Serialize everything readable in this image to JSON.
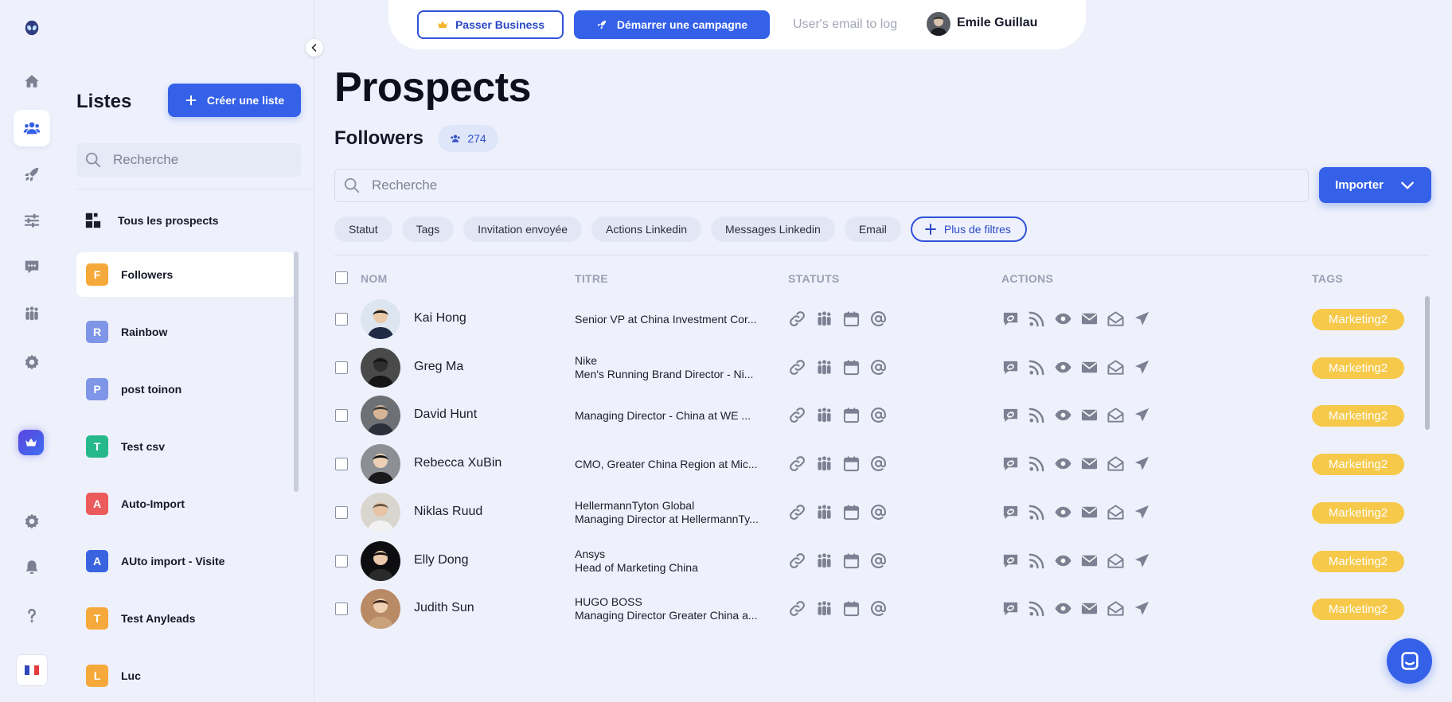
{
  "colors": {
    "primary": "#3560e8",
    "tag": "#f6c94a",
    "background": "#eef1fb",
    "icon": "#7b8092"
  },
  "rail": {
    "items": [
      {
        "icon": "alien-logo-icon"
      },
      {
        "icon": "home-icon"
      },
      {
        "icon": "users-icon",
        "active": true
      },
      {
        "icon": "rocket-icon"
      },
      {
        "icon": "sliders-icon"
      },
      {
        "icon": "chat-icon"
      },
      {
        "icon": "team-icon"
      },
      {
        "icon": "gear-icon"
      },
      {
        "icon": "crown-icon"
      },
      {
        "icon": "gear-icon"
      },
      {
        "icon": "bell-icon"
      },
      {
        "icon": "help-icon"
      },
      {
        "icon": "french-flag-icon"
      }
    ]
  },
  "lists": {
    "title": "Listes",
    "create_label": "Créer une liste",
    "search_placeholder": "Recherche",
    "all_prospects": "Tous les prospects",
    "items": [
      {
        "letter": "F",
        "label": "Followers",
        "color": "#f6a93b",
        "active": true
      },
      {
        "letter": "R",
        "label": "Rainbow",
        "color": "#7f95e8"
      },
      {
        "letter": "P",
        "label": "post toinon",
        "color": "#7f95e8"
      },
      {
        "letter": "T",
        "label": "Test csv",
        "color": "#27b88a"
      },
      {
        "letter": "A",
        "label": "Auto-Import",
        "color": "#ec5b5b"
      },
      {
        "letter": "A",
        "label": "AUto import - Visite",
        "color": "#3a63e0"
      },
      {
        "letter": "T",
        "label": "Test Anyleads",
        "color": "#f6a93b"
      },
      {
        "letter": "L",
        "label": "Luc",
        "color": "#f6a93b"
      }
    ]
  },
  "topbar": {
    "business_label": "Passer Business",
    "campaign_label": "Démarrer une campagne",
    "email_placeholder": "User's email to log",
    "user_name": "Emile Guillau"
  },
  "main": {
    "title": "Prospects",
    "list_name": "Followers",
    "count": "274",
    "search_placeholder": "Recherche",
    "import_label": "Importer",
    "filters": [
      "Statut",
      "Tags",
      "Invitation envoyée",
      "Actions Linkedin",
      "Messages Linkedin",
      "Email"
    ],
    "more_filters": "Plus de filtres",
    "columns": {
      "name": "NOM",
      "title": "TITRE",
      "status": "STATUTS",
      "actions": "ACTIONS",
      "tags": "TAGS"
    }
  },
  "prospects": [
    {
      "name": "Kai Hong",
      "company": "",
      "title": "Senior VP at China Investment Cor...",
      "tag": "Marketing2"
    },
    {
      "name": "Greg Ma",
      "company": "Nike",
      "title": "Men's Running Brand Director - Ni...",
      "tag": "Marketing2"
    },
    {
      "name": "David Hunt",
      "company": "",
      "title": "Managing Director - China at WE ...",
      "tag": "Marketing2"
    },
    {
      "name": "Rebecca XuBin",
      "company": "",
      "title": "CMO, Greater China Region at Mic...",
      "tag": "Marketing2"
    },
    {
      "name": "Niklas Ruud",
      "company": "HellermannTyton Global",
      "title": "Managing Director at HellermannTy...",
      "tag": "Marketing2"
    },
    {
      "name": "Elly Dong",
      "company": "Ansys",
      "title": "Head of Marketing China",
      "tag": "Marketing2"
    },
    {
      "name": "Judith Sun",
      "company": "HUGO BOSS",
      "title": "Managing Director Greater China a...",
      "tag": "Marketing2"
    }
  ]
}
